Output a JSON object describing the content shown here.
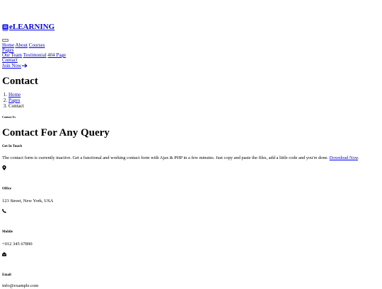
{
  "brand": {
    "name": "eLEARNING",
    "icon": "book-icon"
  },
  "nav": {
    "home": "Home",
    "about": "About",
    "courses": "Courses",
    "pages": "Pages",
    "our_team": "Our Team",
    "testimonial": "Testimonial",
    "page_404": "404 Page",
    "contact": "Contact",
    "join_now": "Join Now",
    "join_icon": "arrow-right-icon"
  },
  "hero": {
    "title": "Contact",
    "breadcrumb": [
      {
        "num": "1.",
        "label": "Home"
      },
      {
        "num": "2.",
        "label": "Pages"
      },
      {
        "num": "3.",
        "label": "Contact"
      }
    ]
  },
  "contact": {
    "eyebrow": "Contact Us",
    "title": "Contact For Any Query",
    "get_in_touch": "Get In Touch",
    "description": "The contact form is currently inactive. Get a functional and working contact form with Ajax & PHP in a few minutes. Just copy and paste the files, add a little code and you're done.",
    "download_link": "Download Now",
    "description_end": ".",
    "office_label": "Office",
    "office_value": "123 Street, New York, USA",
    "mobile_label": "Mobile",
    "mobile_value": "+012 345 67890",
    "email_label": "Email",
    "email_value": "info@example.com",
    "icons": [
      "map-marker-icon",
      "phone-icon",
      "envelope-open-icon"
    ]
  },
  "colors": {
    "link": "#0000ee",
    "text": "#000000",
    "background": "#ffffff"
  }
}
